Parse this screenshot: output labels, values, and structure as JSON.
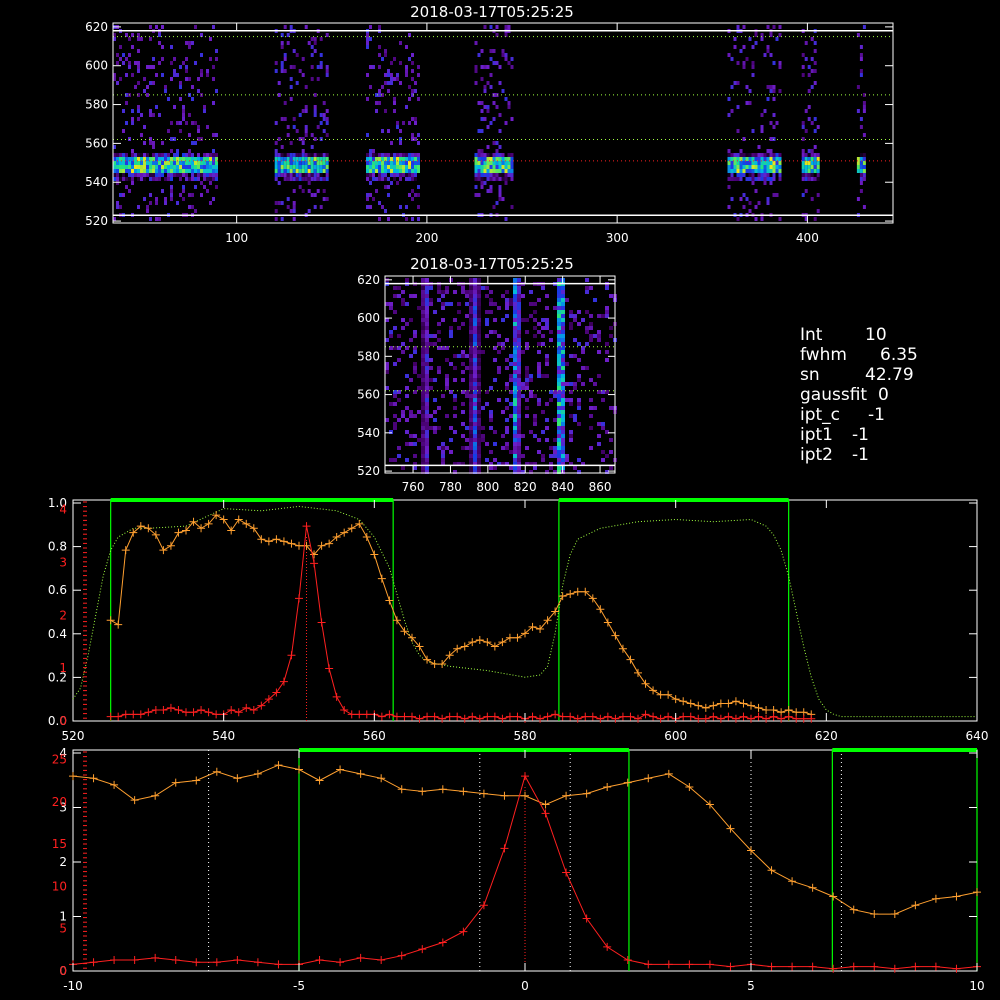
{
  "titles": {
    "top_image": "2018-03-17T05:25:25",
    "zoom_image": "2018-03-17T05:25:25"
  },
  "info": [
    {
      "label": "Int",
      "value": "10"
    },
    {
      "label": "fwhm",
      "value": "6.35"
    },
    {
      "label": "sn",
      "value": "42.79"
    },
    {
      "label": "gaussfit",
      "value": "0"
    },
    {
      "label": "ipt_c",
      "value": "-1"
    },
    {
      "label": "ipt1",
      "value": "-1"
    },
    {
      "label": "ipt2",
      "value": "-1"
    }
  ],
  "colors": {
    "red": "#ff2020",
    "orange": "#ffa030",
    "green": "#00ff00",
    "dotted_green": "#a0ff40",
    "dotted_white": "#ffffff"
  },
  "chart_data": [
    {
      "type": "heatmap",
      "name": "top_image",
      "title": "2018-03-17T05:25:25",
      "xlim": [
        35,
        445
      ],
      "ylim": [
        519,
        622
      ],
      "xticks": [
        100,
        200,
        300,
        400
      ],
      "yticks": [
        520,
        540,
        560,
        580,
        600,
        620
      ],
      "bright_row": 549,
      "bands": [
        [
          35,
          90
        ],
        [
          120,
          147
        ],
        [
          168,
          195
        ],
        [
          225,
          245
        ],
        [
          358,
          385
        ],
        [
          397,
          405
        ],
        [
          426,
          430
        ]
      ],
      "hlines_dotted": [
        551,
        562,
        585,
        615
      ],
      "hlines_solid": [
        523,
        618
      ]
    },
    {
      "type": "heatmap",
      "name": "zoom_image",
      "title": "2018-03-17T05:25:25",
      "xlim": [
        745,
        868
      ],
      "ylim": [
        519,
        622
      ],
      "xticks": [
        760,
        780,
        800,
        820,
        840,
        860
      ],
      "yticks": [
        520,
        540,
        560,
        580,
        600,
        620
      ],
      "streaks": [
        [
          766,
          0.5
        ],
        [
          792,
          0.6
        ],
        [
          814,
          0.8
        ],
        [
          838,
          1.0
        ]
      ],
      "hlines_dotted": [
        562,
        585
      ],
      "hlines_solid": [
        523,
        618
      ]
    },
    {
      "type": "line",
      "name": "profile_wavelength",
      "xlim": [
        520,
        640
      ],
      "xticks": [
        520,
        540,
        560,
        580,
        600,
        620,
        640
      ],
      "ylim": [
        0,
        1
      ],
      "yticks_left_white": [
        "0.0",
        "0.2",
        "0.4",
        "0.6",
        "0.8",
        "1.0"
      ],
      "yticks_left_red": [
        "0",
        "1",
        "2",
        "3",
        "4"
      ],
      "windows": [
        [
          525,
          562.5
        ],
        [
          584.5,
          615
        ]
      ],
      "center": 551,
      "red": {
        "x": [
          525,
          526,
          527,
          528,
          529,
          530,
          531,
          532,
          533,
          534,
          535,
          536,
          537,
          538,
          539,
          540,
          541,
          542,
          543,
          544,
          545,
          546,
          547,
          548,
          549,
          550,
          551,
          552,
          553,
          554,
          555,
          556,
          557,
          558,
          559,
          560,
          561,
          562,
          563,
          564,
          565,
          566,
          567,
          568,
          569,
          570,
          571,
          572,
          573,
          574,
          575,
          576,
          577,
          578,
          579,
          580,
          581,
          582,
          583,
          584,
          585,
          586,
          587,
          588,
          589,
          590,
          591,
          592,
          593,
          594,
          595,
          596,
          597,
          598,
          599,
          600,
          601,
          602,
          603,
          604,
          605,
          606,
          607,
          608,
          609,
          610,
          611,
          612,
          613,
          614,
          615,
          616,
          617,
          618
        ],
        "y": [
          0.02,
          0.02,
          0.03,
          0.03,
          0.03,
          0.04,
          0.05,
          0.05,
          0.06,
          0.05,
          0.04,
          0.04,
          0.05,
          0.04,
          0.03,
          0.03,
          0.05,
          0.04,
          0.06,
          0.05,
          0.07,
          0.1,
          0.13,
          0.18,
          0.3,
          0.56,
          0.89,
          0.72,
          0.45,
          0.24,
          0.11,
          0.05,
          0.03,
          0.03,
          0.03,
          0.03,
          0.02,
          0.03,
          0.02,
          0.02,
          0.02,
          0.01,
          0.02,
          0.02,
          0.01,
          0.02,
          0.02,
          0.01,
          0.02,
          0.01,
          0.02,
          0.02,
          0.01,
          0.02,
          0.02,
          0.01,
          0.02,
          0.01,
          0.02,
          0.03,
          0.02,
          0.02,
          0.01,
          0.02,
          0.02,
          0.01,
          0.02,
          0.01,
          0.02,
          0.02,
          0.01,
          0.03,
          0.02,
          0.01,
          0.02,
          0.01,
          0.02,
          0.02,
          0.01,
          0.01,
          0.02,
          0.01,
          0.02,
          0.01,
          0.02,
          0.01,
          0.02,
          0.01,
          0.02,
          0.01,
          0.02,
          0.01,
          0.01,
          0.01
        ]
      },
      "orange": {
        "x": [
          525,
          526,
          527,
          528,
          529,
          530,
          531,
          532,
          533,
          534,
          535,
          536,
          537,
          538,
          539,
          540,
          541,
          542,
          543,
          544,
          545,
          546,
          547,
          548,
          549,
          550,
          551,
          552,
          553,
          554,
          555,
          556,
          557,
          558,
          559,
          560,
          561,
          562,
          563,
          564,
          565,
          566,
          567,
          568,
          569,
          570,
          571,
          572,
          573,
          574,
          575,
          576,
          577,
          578,
          579,
          580,
          581,
          582,
          583,
          584,
          585,
          586,
          587,
          588,
          589,
          590,
          591,
          592,
          593,
          594,
          595,
          596,
          597,
          598,
          599,
          600,
          601,
          602,
          603,
          604,
          605,
          606,
          607,
          608,
          609,
          610,
          611,
          612,
          613,
          614,
          615,
          616,
          617,
          618
        ],
        "y": [
          0.46,
          0.44,
          0.78,
          0.86,
          0.89,
          0.88,
          0.85,
          0.78,
          0.8,
          0.86,
          0.87,
          0.91,
          0.88,
          0.9,
          0.94,
          0.92,
          0.87,
          0.92,
          0.9,
          0.88,
          0.83,
          0.82,
          0.83,
          0.82,
          0.81,
          0.8,
          0.8,
          0.76,
          0.8,
          0.81,
          0.84,
          0.86,
          0.88,
          0.9,
          0.84,
          0.76,
          0.65,
          0.55,
          0.46,
          0.41,
          0.38,
          0.34,
          0.28,
          0.26,
          0.26,
          0.3,
          0.33,
          0.34,
          0.36,
          0.37,
          0.36,
          0.34,
          0.36,
          0.38,
          0.38,
          0.4,
          0.43,
          0.42,
          0.46,
          0.5,
          0.57,
          0.58,
          0.59,
          0.59,
          0.56,
          0.51,
          0.45,
          0.39,
          0.33,
          0.28,
          0.22,
          0.17,
          0.14,
          0.12,
          0.12,
          0.1,
          0.09,
          0.08,
          0.07,
          0.06,
          0.07,
          0.08,
          0.08,
          0.09,
          0.08,
          0.07,
          0.06,
          0.05,
          0.05,
          0.04,
          0.05,
          0.04,
          0.04,
          0.03
        ]
      },
      "filter": {
        "x": [
          520,
          521,
          522,
          523,
          524,
          525,
          526,
          527,
          528,
          530,
          535,
          540,
          545,
          550,
          555,
          558,
          560,
          562,
          563,
          564,
          565,
          566,
          567,
          570,
          575,
          580,
          582,
          583,
          584,
          585,
          586,
          587,
          590,
          595,
          600,
          605,
          610,
          612,
          613,
          614,
          615,
          616,
          617,
          618,
          619,
          620,
          621,
          622,
          625,
          630,
          635,
          640
        ],
        "y": [
          0.1,
          0.15,
          0.3,
          0.48,
          0.66,
          0.78,
          0.84,
          0.86,
          0.88,
          0.88,
          0.89,
          0.97,
          0.96,
          0.98,
          0.96,
          0.92,
          0.84,
          0.7,
          0.58,
          0.46,
          0.36,
          0.3,
          0.27,
          0.25,
          0.23,
          0.2,
          0.21,
          0.25,
          0.4,
          0.62,
          0.76,
          0.83,
          0.88,
          0.91,
          0.92,
          0.91,
          0.92,
          0.89,
          0.85,
          0.78,
          0.66,
          0.5,
          0.34,
          0.2,
          0.1,
          0.05,
          0.03,
          0.02,
          0.02,
          0.02,
          0.02,
          0.02
        ]
      }
    },
    {
      "type": "line",
      "name": "profile_offset",
      "xlim": [
        -10,
        10
      ],
      "xticks": [
        -10,
        -5,
        0,
        5,
        10
      ],
      "ylim": [
        0,
        1
      ],
      "yticks_left_white": [
        "0",
        "1",
        "2",
        "3",
        "4"
      ],
      "yticks_left_red": [
        "0",
        "5",
        "10",
        "15",
        "20",
        "25"
      ],
      "windows": [
        [
          -5,
          2.3
        ],
        [
          6.8,
          10
        ]
      ],
      "dotted_vlines": [
        -7,
        -5,
        -1,
        1,
        5,
        7
      ],
      "center": 0
    }
  ]
}
